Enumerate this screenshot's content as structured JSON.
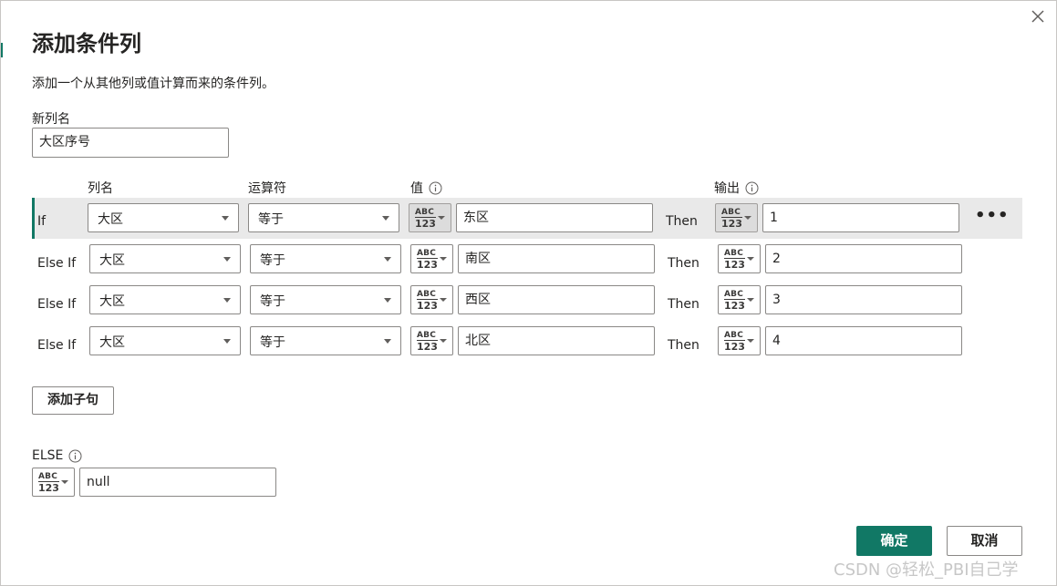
{
  "dialog": {
    "title": "添加条件列",
    "description": "添加一个从其他列或值计算而来的条件列。",
    "close_icon": "close-icon"
  },
  "new_column": {
    "label": "新列名",
    "value": "大区序号"
  },
  "headers": {
    "column_name": "列名",
    "operator": "运算符",
    "value": "值",
    "output": "输出"
  },
  "type_label": {
    "abc": "ABC",
    "num": "123"
  },
  "rows": [
    {
      "label": "If",
      "then": "Then",
      "column": "大区",
      "operator": "等于",
      "value": "东区",
      "output": "1"
    },
    {
      "label": "Else If",
      "then": "Then",
      "column": "大区",
      "operator": "等于",
      "value": "南区",
      "output": "2"
    },
    {
      "label": "Else If",
      "then": "Then",
      "column": "大区",
      "operator": "等于",
      "value": "西区",
      "output": "3"
    },
    {
      "label": "Else If",
      "then": "Then",
      "column": "大区",
      "operator": "等于",
      "value": "北区",
      "output": "4"
    }
  ],
  "more_icon": "ellipsis-icon",
  "add_clause_label": "添加子句",
  "else": {
    "label": "ELSE",
    "value": "null"
  },
  "buttons": {
    "ok": "确定",
    "cancel": "取消"
  },
  "watermark": "CSDN @轻松_PBI自己学",
  "colors": {
    "accent": "#117865",
    "selected_row_bg": "#e9e9e9"
  }
}
